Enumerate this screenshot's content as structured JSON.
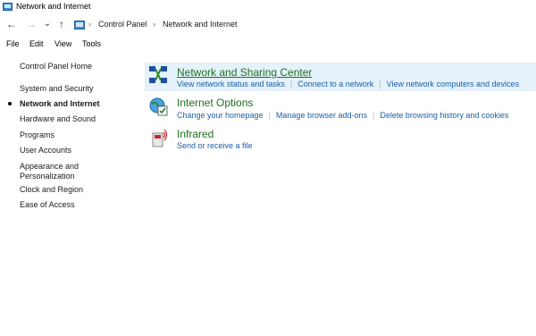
{
  "window": {
    "title": "Network and Internet"
  },
  "nav": {
    "back_icon": "←",
    "forward_icon": "→",
    "recent_icon": "⌄",
    "up_icon": "↑"
  },
  "breadcrumb": {
    "items": [
      "Control Panel",
      "Network and Internet"
    ],
    "separator": "›"
  },
  "menu": {
    "items": [
      "File",
      "Edit",
      "View",
      "Tools"
    ]
  },
  "sidebar": {
    "items": [
      {
        "label": "Control Panel Home"
      },
      {
        "label": "System and Security"
      },
      {
        "label": "Network and Internet",
        "active": true
      },
      {
        "label": "Hardware and Sound"
      },
      {
        "label": "Programs"
      },
      {
        "label": "User Accounts"
      },
      {
        "label": "Appearance and"
      },
      {
        "label": "Personalization"
      },
      {
        "label": "Clock and Region"
      },
      {
        "label": "Ease of Access"
      }
    ]
  },
  "categories": [
    {
      "title": "Network and Sharing Center",
      "icon": "network-sharing-icon",
      "links": [
        "View network status and tasks",
        "Connect to a network",
        "View network computers and devices"
      ]
    },
    {
      "title": "Internet Options",
      "icon": "internet-options-icon",
      "links": [
        "Change your homepage",
        "Manage browser add-ons",
        "Delete browsing history and cookies"
      ]
    },
    {
      "title": "Infrared",
      "icon": "infrared-icon",
      "links": [
        "Send or receive a file"
      ]
    }
  ],
  "colors": {
    "selected_bg": "#e5f1fb",
    "title_green": "#1f6f1f",
    "link_blue": "#1a5fa8"
  }
}
